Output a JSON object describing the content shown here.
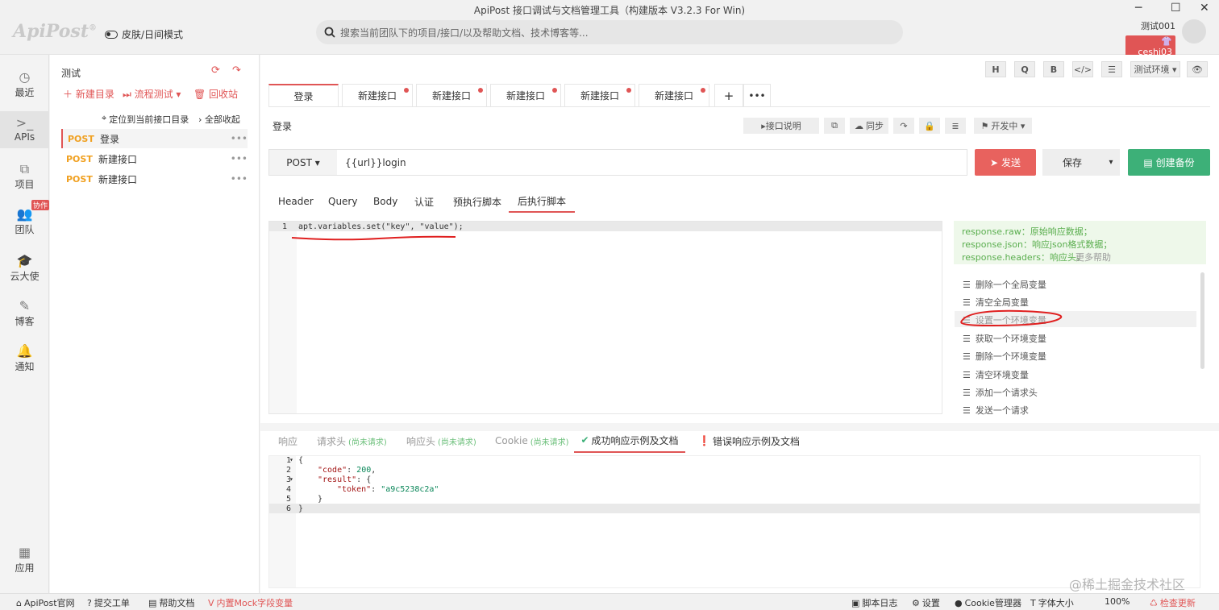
{
  "window": {
    "title": "ApiPost 接口调试与文档管理工具（构建版本 V3.2.3 For Win)",
    "min": "─",
    "max": "☐",
    "close": "✕"
  },
  "header": {
    "logo": "ApiPost",
    "logo_mark": "®",
    "skin_mode": "皮肤/日间模式",
    "search_placeholder": "搜索当前团队下的项目/接口/以及帮助文档、技术博客等...",
    "user_name": "测试001",
    "user_badge": "ceshi03"
  },
  "sidebar": {
    "items": [
      {
        "label": "最近",
        "icon": "clock-icon"
      },
      {
        "label": "APIs",
        "icon": "terminal-icon"
      },
      {
        "label": "项目",
        "icon": "project-icon"
      },
      {
        "label": "团队",
        "icon": "team-icon",
        "badge": "协作"
      },
      {
        "label": "云大使",
        "icon": "graduate-icon"
      },
      {
        "label": "博客",
        "icon": "edit-icon"
      },
      {
        "label": "通知",
        "icon": "bell-icon"
      },
      {
        "label": "应用",
        "icon": "grid-icon"
      }
    ]
  },
  "tree": {
    "title": "测试",
    "new_dir": "＋ 新建目录",
    "flow_test": "⏭ 流程测试 ▾",
    "recycle": "🗑 回收站",
    "locate": "定位到当前接口目录",
    "collapse": "› 全部收起",
    "items": [
      {
        "method": "POST",
        "name": "登录"
      },
      {
        "method": "POST",
        "name": "新建接口"
      },
      {
        "method": "POST",
        "name": "新建接口"
      }
    ]
  },
  "toolbar": {
    "h": "H",
    "q": "Q",
    "b": "B",
    "code": "</>",
    "adjust": "☰",
    "env": "测试环境 ▾",
    "eye": "👁"
  },
  "tabs": [
    {
      "label": "登录"
    },
    {
      "label": "新建接口"
    },
    {
      "label": "新建接口"
    },
    {
      "label": "新建接口"
    },
    {
      "label": "新建接口"
    },
    {
      "label": "新建接口"
    }
  ],
  "tab_add": "+",
  "tab_more": "•••",
  "request": {
    "name": "登录",
    "desc_btn": "▸接口说明",
    "sync": "同步",
    "status": "开发中 ▾",
    "method": "POST ▾",
    "url": "{{url}}login",
    "send": "发送",
    "save": "保存",
    "save_arrow": "▾",
    "backup": "创建备份"
  },
  "subtabs": [
    "Header",
    "Query",
    "Body",
    "认证",
    "预执行脚本",
    "后执行脚本"
  ],
  "editor": {
    "line": "1",
    "code": "apt.variables.set(\"key\", \"value\");"
  },
  "hints": [
    "response.raw：原始响应数据；",
    "response.json：响应json格式数据；",
    "response.headers：响应头。"
  ],
  "more_help": "更多帮助",
  "functions": [
    "删除一个全局变量",
    "清空全局变量",
    "设置一个环境变量",
    "获取一个环境变量",
    "删除一个环境变量",
    "清空环境变量",
    "添加一个请求头",
    "发送一个请求"
  ],
  "response_tabs": {
    "resp": "响应",
    "req_head": "请求头",
    "resp_head": "响应头",
    "cookie": "Cookie",
    "not_requested": "(尚未请求)",
    "success": "成功响应示例及文档",
    "error": "错误响应示例及文档"
  },
  "response_code": {
    "lines": [
      "1",
      "2",
      "3",
      "4",
      "5",
      "6"
    ],
    "folds": [
      "▾",
      "",
      "▾",
      "",
      "",
      ""
    ],
    "l1": "{",
    "l2_key": "\"code\"",
    "l2_val": "200",
    "l3_key": "\"result\"",
    "l3_tail": ": {",
    "l4_key": "\"token\"",
    "l4_val": "\"a9c5238c2a\"",
    "l5": "}",
    "l6": "}"
  },
  "status_bar": {
    "site": "ApiPost官网",
    "ticket": "提交工单",
    "help": "帮助文档",
    "mock": "内置Mock字段变量",
    "log": "脚本日志",
    "settings": "设置",
    "cookie": "Cookie管理器",
    "font": "字体大小",
    "zoom": "100%",
    "update": "检查更新",
    "watermark": "@稀土掘金技术社区"
  }
}
